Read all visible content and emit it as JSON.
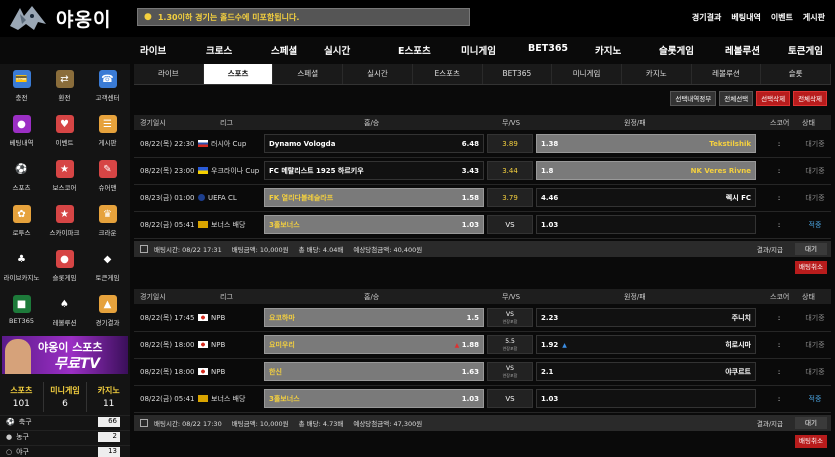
{
  "brand": {
    "name": "야옹이"
  },
  "notice": {
    "text": "1.30이하 경기는 홀드수에 미포함됩니다."
  },
  "top_links": [
    "경기결과",
    "베팅내역",
    "이벤트",
    "게시판"
  ],
  "main_nav": [
    "라이브",
    "크로스",
    "스페셜",
    "실시간",
    "E스포츠",
    "미니게임",
    "BET365",
    "카지노",
    "슬롯게임",
    "레볼루션",
    "토큰게임"
  ],
  "sidebar": {
    "icons": [
      {
        "label": "충전",
        "icon": "charge-icon",
        "color": "#3a7bd5"
      },
      {
        "label": "환전",
        "icon": "exchange-icon",
        "color": "#8a6d3b"
      },
      {
        "label": "고객센터",
        "icon": "support-icon",
        "color": "#3a7bd5"
      },
      {
        "label": "베팅내역",
        "icon": "betting-history-icon",
        "color": "#9b2fc4"
      },
      {
        "label": "이벤트",
        "icon": "event-icon",
        "color": "#d64545"
      },
      {
        "label": "게시판",
        "icon": "board-icon",
        "color": "#e6a23c"
      },
      {
        "label": "스포츠",
        "icon": "sports-icon",
        "color": "#ddd"
      },
      {
        "label": "보스코어",
        "icon": "boscore-icon",
        "color": "#d64545"
      },
      {
        "label": "슈어맨",
        "icon": "sureman-icon",
        "color": "#d64545"
      },
      {
        "label": "로투스",
        "icon": "lotus-icon",
        "color": "#e6a23c"
      },
      {
        "label": "스카이파크",
        "icon": "skypark-icon",
        "color": "#d64545"
      },
      {
        "label": "크라운",
        "icon": "crown-icon",
        "color": "#e6a23c"
      },
      {
        "label": "라이브카지노",
        "icon": "live-casino-icon",
        "color": "#ddd"
      },
      {
        "label": "슬롯게임",
        "icon": "slot-icon",
        "color": "#d64545"
      },
      {
        "label": "토큰게임",
        "icon": "token-icon",
        "color": "#ddd"
      },
      {
        "label": "BET365",
        "icon": "bet365-icon",
        "color": "#1d7a3a"
      },
      {
        "label": "레볼루션",
        "icon": "evolution-icon",
        "color": "#ddd"
      },
      {
        "label": "경기결과",
        "icon": "results-icon",
        "color": "#e6a23c"
      }
    ],
    "tv_banner": {
      "line1": "야옹이 스포츠",
      "line2": "무료TV"
    },
    "counts": [
      {
        "label": "스포츠",
        "value": "101",
        "color": "#f4d03f"
      },
      {
        "label": "미니게임",
        "value": "6",
        "color": "#f4d03f"
      },
      {
        "label": "카지노",
        "value": "11",
        "color": "#f4d03f"
      }
    ],
    "sports": [
      {
        "name": "축구",
        "count": "66",
        "icon": "soccer-icon"
      },
      {
        "name": "농구",
        "count": "2",
        "icon": "basketball-icon"
      },
      {
        "name": "야구",
        "count": "13",
        "icon": "baseball-icon"
      }
    ]
  },
  "tabs": [
    "라이브",
    "스포츠",
    "스페셜",
    "실시간",
    "E스포츠",
    "BET365",
    "미니게임",
    "카지노",
    "레볼루션",
    "슬롯"
  ],
  "active_tab": 1,
  "buttons": [
    {
      "label": "선택내역정부",
      "style": "dark"
    },
    {
      "label": "전체선택",
      "style": "dark"
    },
    {
      "label": "선택삭제",
      "style": "red"
    },
    {
      "label": "전체삭제",
      "style": "red"
    }
  ],
  "headers": [
    "경기일시",
    "리그",
    "홈/승",
    "무/VS",
    "원정/패",
    "스코어",
    "상태"
  ],
  "section1": {
    "rows": [
      {
        "date": "08/22(목) 22:30",
        "league": "러시아 Cup",
        "flag": "ru",
        "home": "Dynamo Vologda",
        "home_odds": "6.48",
        "home_sel": false,
        "mid": "3.89",
        "mid_gold": true,
        "away": "Tekstilshik",
        "away_odds": "1.38",
        "away_sel": true,
        "score": ":",
        "status": "대기중"
      },
      {
        "date": "08/22(목) 23:00",
        "league": "우크라이나 Cup",
        "flag": "ua",
        "home": "FC 메탈리스트 1925 하르키우",
        "home_odds": "3.43",
        "home_sel": false,
        "mid": "3.44",
        "mid_gold": true,
        "away": "NK Veres Rivne",
        "away_odds": "1.8",
        "away_sel": true,
        "score": ":",
        "status": "대기중"
      },
      {
        "date": "08/23(금) 01:00",
        "league": "UEFA CL",
        "flag": "eu",
        "home": "FK 열리다볼레슬라프",
        "home_odds": "1.58",
        "home_sel": true,
        "mid": "3.79",
        "mid_gold": true,
        "away": "렉시 FC",
        "away_odds": "4.46",
        "away_sel": false,
        "score": ":",
        "status": "대기중"
      },
      {
        "date": "08/22(금) 05:41",
        "league": "보너스 배당",
        "flag": "bonus",
        "home": "3홀보너스",
        "home_odds": "1.03",
        "home_sel": true,
        "mid": "VS",
        "mid_gold": false,
        "away": "",
        "away_odds": "1.03",
        "away_sel": false,
        "score": ":",
        "status": "적중"
      }
    ],
    "summary": {
      "bet_time": "배팅시간: 08/22 17:31",
      "bet_amount": "배팅금액: 10,000원",
      "total_odds": "총 배당: 4.04배",
      "expected": "예상당첨금액: 40,400원",
      "result": "결과/지급",
      "status_btn": "대기"
    },
    "cancel": "배팅취소"
  },
  "section2": {
    "rows": [
      {
        "date": "08/22(목) 17:45",
        "league": "NPB",
        "flag": "jp",
        "home": "요코하마",
        "home_odds": "1.5",
        "home_sel": true,
        "mid": "VS",
        "mid_sub": "연장포함",
        "away": "주니치",
        "away_odds": "2.23",
        "away_sel": false,
        "arrow": "",
        "score": ":",
        "status": "대기중"
      },
      {
        "date": "08/22(목) 18:00",
        "league": "NPB",
        "flag": "jp",
        "home": "요미우리",
        "home_odds": "1.88",
        "home_sel": true,
        "home_arrow": "up",
        "mid": "5.5",
        "mid_sub": "연장포함",
        "away": "히로시마",
        "away_odds": "1.92",
        "away_sel": false,
        "arrow": "down",
        "score": ":",
        "status": "대기중"
      },
      {
        "date": "08/22(목) 18:00",
        "league": "NPB",
        "flag": "jp",
        "home": "한신",
        "home_odds": "1.63",
        "home_sel": true,
        "mid": "VS",
        "mid_sub": "연장포함",
        "away": "야쿠르트",
        "away_odds": "2.1",
        "away_sel": false,
        "arrow": "",
        "score": ":",
        "status": "대기중"
      },
      {
        "date": "08/22(금) 05:41",
        "league": "보너스 배당",
        "flag": "bonus",
        "home": "3홀보너스",
        "home_odds": "1.03",
        "home_sel": true,
        "mid": "VS",
        "mid_sub": "",
        "away": "",
        "away_odds": "1.03",
        "away_sel": false,
        "arrow": "",
        "score": ":",
        "status": "적중"
      }
    ],
    "summary": {
      "bet_time": "배팅시간: 08/22 17:30",
      "bet_amount": "배팅금액: 10,000원",
      "total_odds": "총 배당: 4.73배",
      "expected": "예상당첨금액: 47,300원",
      "result": "결과/지급",
      "status_btn": "대기"
    },
    "cancel": "배팅취소"
  }
}
